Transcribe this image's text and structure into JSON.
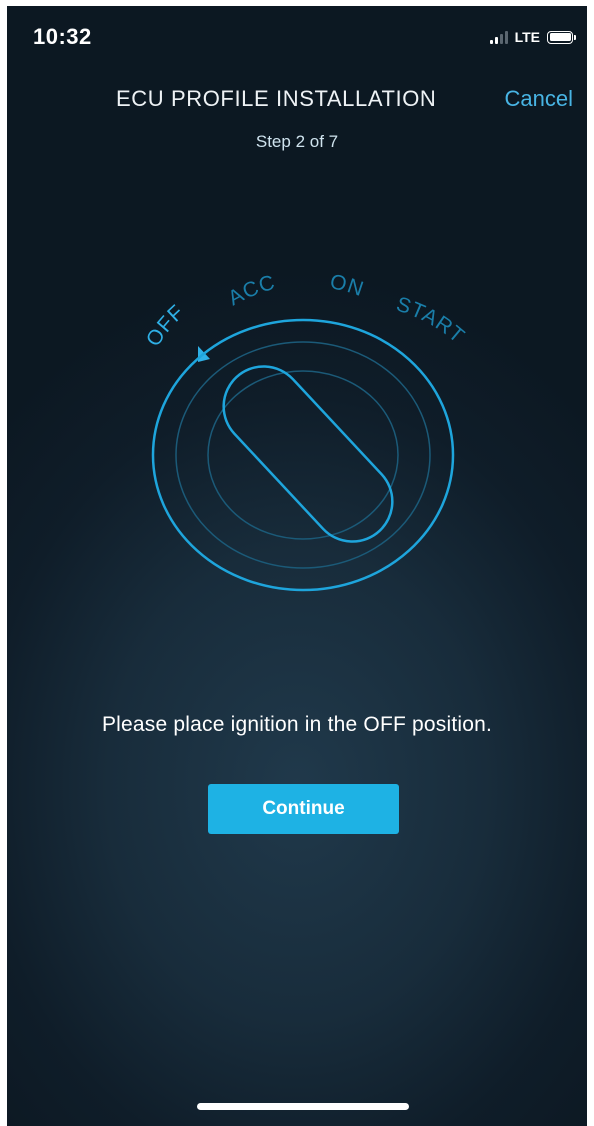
{
  "status_bar": {
    "time": "10:32",
    "network": "LTE",
    "signal_bars_active": 2,
    "signal_bars_total": 4,
    "battery_level": 1.0
  },
  "header": {
    "title": "ECU PROFILE INSTALLATION",
    "cancel_label": "Cancel",
    "step": "Step 2 of 7"
  },
  "ignition": {
    "positions": {
      "off": "OFF",
      "acc": "ACC",
      "on": "ON",
      "start": "START"
    },
    "selected": "OFF",
    "accent_color": "#1ea5dc"
  },
  "instruction": "Please place ignition in the OFF position.",
  "continue_label": "Continue",
  "colors": {
    "accent": "#1eb2e4",
    "cancel_link": "#48b4e4",
    "background_dark": "#0f1d29"
  }
}
